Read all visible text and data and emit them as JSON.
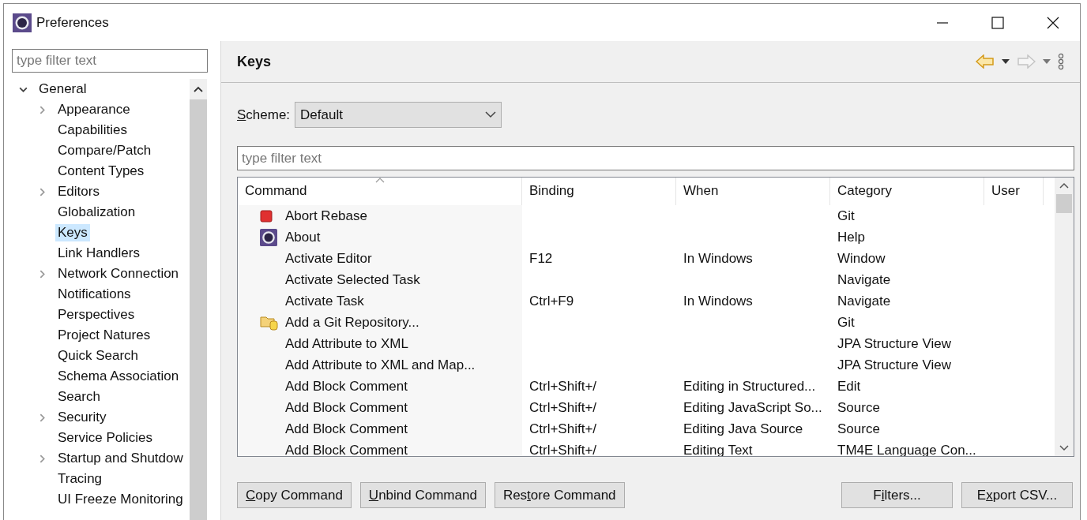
{
  "window": {
    "title": "Preferences"
  },
  "sidebar": {
    "filter_placeholder": "type filter text",
    "tree": [
      {
        "label": "General",
        "expanded": true,
        "selected": false,
        "children": [
          {
            "label": "Appearance",
            "expandable": true,
            "selected": false
          },
          {
            "label": "Capabilities",
            "expandable": false,
            "selected": false
          },
          {
            "label": "Compare/Patch",
            "expandable": false,
            "selected": false
          },
          {
            "label": "Content Types",
            "expandable": false,
            "selected": false
          },
          {
            "label": "Editors",
            "expandable": true,
            "selected": false
          },
          {
            "label": "Globalization",
            "expandable": false,
            "selected": false
          },
          {
            "label": "Keys",
            "expandable": false,
            "selected": true
          },
          {
            "label": "Link Handlers",
            "expandable": false,
            "selected": false
          },
          {
            "label": "Network Connection",
            "expandable": true,
            "selected": false
          },
          {
            "label": "Notifications",
            "expandable": false,
            "selected": false
          },
          {
            "label": "Perspectives",
            "expandable": false,
            "selected": false
          },
          {
            "label": "Project Natures",
            "expandable": false,
            "selected": false
          },
          {
            "label": "Quick Search",
            "expandable": false,
            "selected": false
          },
          {
            "label": "Schema Association",
            "expandable": false,
            "selected": false
          },
          {
            "label": "Search",
            "expandable": false,
            "selected": false
          },
          {
            "label": "Security",
            "expandable": true,
            "selected": false
          },
          {
            "label": "Service Policies",
            "expandable": false,
            "selected": false
          },
          {
            "label": "Startup and Shutdow",
            "expandable": true,
            "selected": false
          },
          {
            "label": "Tracing",
            "expandable": false,
            "selected": false
          },
          {
            "label": "UI Freeze Monitoring",
            "expandable": false,
            "selected": false
          }
        ]
      }
    ]
  },
  "page": {
    "title": "Keys",
    "nav": {
      "back_enabled": true,
      "forward_enabled": false
    },
    "scheme": {
      "label": {
        "key": "S",
        "post": "cheme:"
      },
      "value": "Default"
    },
    "filter_placeholder": "type filter text",
    "table": {
      "columns": [
        {
          "label": "Command",
          "sorted": true
        },
        {
          "label": "Binding",
          "sorted": false
        },
        {
          "label": "When",
          "sorted": false
        },
        {
          "label": "Category",
          "sorted": false
        },
        {
          "label": "User",
          "sorted": false
        }
      ],
      "rows": [
        {
          "kind": "stop",
          "command": "Abort Rebase",
          "category": "Git"
        },
        {
          "kind": "about",
          "command": "About",
          "category": "Help"
        },
        {
          "kind": "plain",
          "command": "Activate Editor",
          "binding": "F12",
          "when": "In Windows",
          "category": "Window"
        },
        {
          "kind": "plain",
          "command": "Activate Selected Task",
          "category": "Navigate"
        },
        {
          "kind": "plain",
          "command": "Activate Task",
          "binding": "Ctrl+F9",
          "when": "In Windows",
          "category": "Navigate"
        },
        {
          "kind": "repository",
          "command": "Add a Git Repository...",
          "category": "Git"
        },
        {
          "kind": "plain",
          "command": "Add Attribute to XML",
          "category": "JPA Structure View"
        },
        {
          "kind": "plain",
          "command": "Add Attribute to XML and Map...",
          "category": "JPA Structure View"
        },
        {
          "kind": "plain",
          "command": "Add Block Comment",
          "binding": "Ctrl+Shift+/",
          "when": "Editing in Structured...",
          "category": "Edit"
        },
        {
          "kind": "plain",
          "command": "Add Block Comment",
          "binding": "Ctrl+Shift+/",
          "when": "Editing JavaScript So...",
          "category": "Source"
        },
        {
          "kind": "plain",
          "command": "Add Block Comment",
          "binding": "Ctrl+Shift+/",
          "when": "Editing Java Source",
          "category": "Source"
        },
        {
          "kind": "plain",
          "command": "Add Block Comment",
          "binding": "Ctrl+Shift+/",
          "when": "Editing Text",
          "category": "TM4E Language Con..."
        }
      ]
    },
    "left_buttons": [
      {
        "key": "C",
        "post": "opy Command"
      },
      {
        "key": "U",
        "post": "nbind Command"
      },
      {
        "pre": "Res",
        "key": "t",
        "post": "ore Command"
      }
    ],
    "right_buttons": [
      {
        "pre": "F",
        "key": "i",
        "post": "lters..."
      },
      {
        "pre": "E",
        "key": "x",
        "post": "port CSV..."
      }
    ]
  }
}
